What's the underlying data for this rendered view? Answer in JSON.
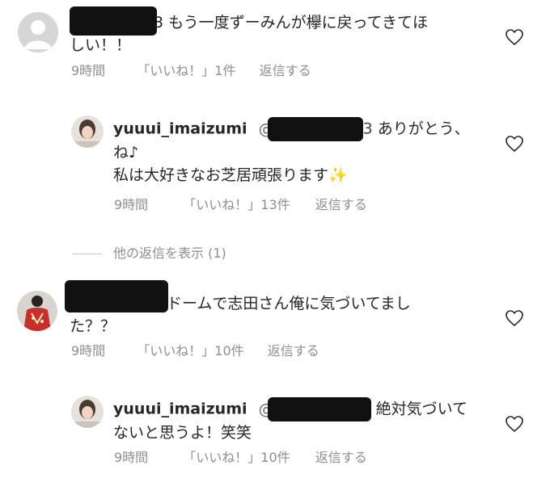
{
  "comments": [
    {
      "avatar": "default-avatar",
      "text_fragment": "3",
      "text": "もう一度ずーみんが欅に戻ってきてほしい！！",
      "text_line1": "もう一度ずーみんが欅に戻ってきてほ",
      "text_line2": "しい！！",
      "time": "9時間",
      "likes": "「いいね！」1件",
      "reply": "返信する"
    },
    {
      "avatar": "user-avatar",
      "username": "yuuui_imaizumi",
      "mention_prefix": "@",
      "mention_suffix": "3",
      "text_line1": "ありがとう、",
      "text_line2": "ね♪",
      "text_line3": "私は大好きなお芝居頑張ります",
      "emoji": "✨",
      "time": "9時間",
      "likes": "「いいね！」13件",
      "reply": "返信する"
    },
    {
      "view_replies": "他の返信を表示 (1)"
    },
    {
      "avatar": "red-shirt-avatar",
      "text_line1": "ドームで志田さん俺に気づいてまし",
      "text_line2": "た？？",
      "time": "9時間",
      "likes": "「いいね！」10件",
      "reply": "返信する"
    },
    {
      "avatar": "user-avatar",
      "username": "yuuui_imaizumi",
      "mention_prefix": "@",
      "text_line1": "絶対気づいて",
      "text_line2": "ないと思うよ！笑笑",
      "time": "9時間",
      "likes": "「いいね！」10件",
      "reply": "返信する"
    }
  ],
  "colors": {
    "text": "#262626",
    "meta": "#8e8e8e",
    "redaction": "#111111"
  },
  "icons": [
    "heart-icon",
    "sparkles-emoji"
  ]
}
